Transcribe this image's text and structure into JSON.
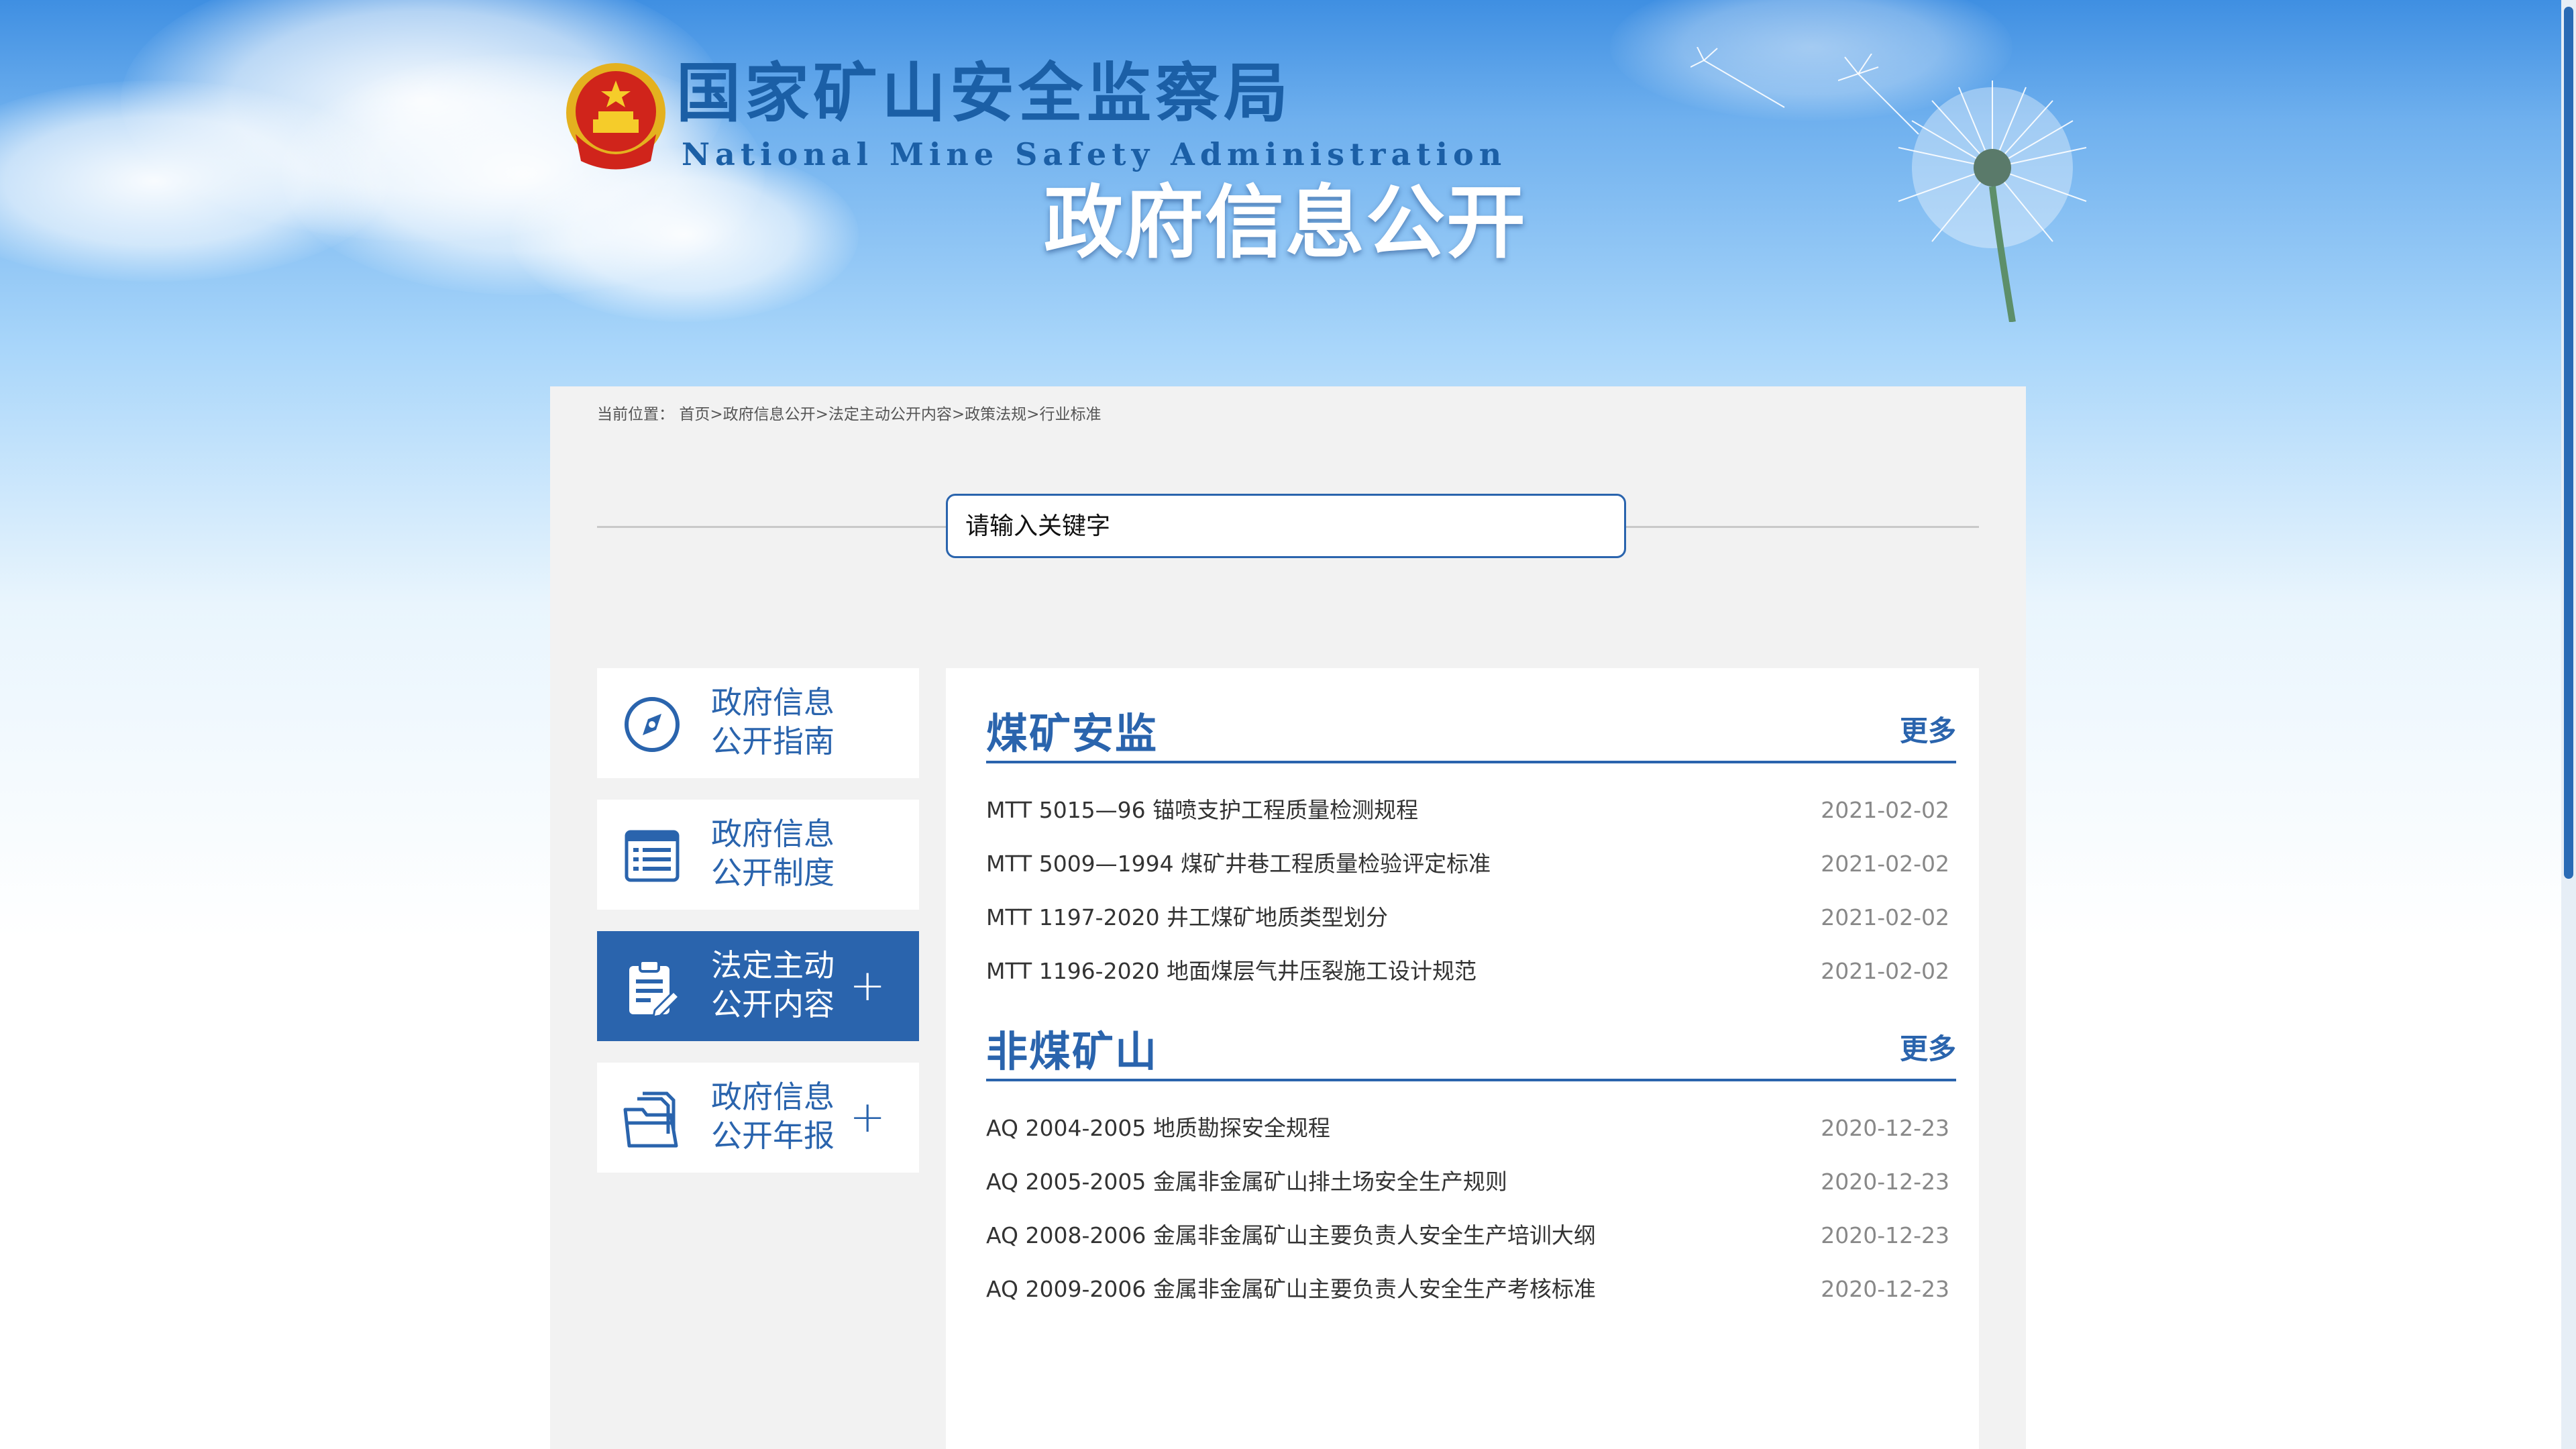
{
  "header": {
    "site_name": "国家矿山安全监察局",
    "site_name_en": "National Mine Safety Administration",
    "banner_title": "政府信息公开"
  },
  "breadcrumb": {
    "prefix": "当前位置：",
    "items": [
      "首页",
      "政府信息公开",
      "法定主动公开内容",
      "政策法规",
      "行业标准"
    ],
    "separator": ">"
  },
  "search": {
    "placeholder": "请输入关键字",
    "value": ""
  },
  "side_nav": {
    "items": [
      {
        "label": "政府信息\n公开指南",
        "icon": "compass-icon",
        "has_plus": false,
        "active": false
      },
      {
        "label": "政府信息\n公开制度",
        "icon": "list-document-icon",
        "has_plus": false,
        "active": false
      },
      {
        "label": "法定主动\n公开内容",
        "icon": "clipboard-edit-icon",
        "has_plus": true,
        "active": true
      },
      {
        "label": "政府信息\n公开年报",
        "icon": "folder-files-icon",
        "has_plus": true,
        "active": false
      }
    ],
    "plus_symbol": "+"
  },
  "sections": [
    {
      "title": "煤矿安监",
      "more": "更多",
      "items": [
        {
          "title": "MTT 5015—96 锚喷支护工程质量检测规程",
          "date": "2021-02-02"
        },
        {
          "title": "MTT 5009—1994 煤矿井巷工程质量检验评定标准",
          "date": "2021-02-02"
        },
        {
          "title": "MTT 1197-2020 井工煤矿地质类型划分",
          "date": "2021-02-02"
        },
        {
          "title": "MTT 1196-2020 地面煤层气井压裂施工设计规范",
          "date": "2021-02-02"
        }
      ]
    },
    {
      "title": "非煤矿山",
      "more": "更多",
      "items": [
        {
          "title": "AQ 2004-2005 地质勘探安全规程",
          "date": "2020-12-23"
        },
        {
          "title": "AQ 2005-2005 金属非金属矿山排土场安全生产规则",
          "date": "2020-12-23"
        },
        {
          "title": "AQ 2008-2006 金属非金属矿山主要负责人安全生产培训大纲",
          "date": "2020-12-23"
        },
        {
          "title": "AQ 2009-2006 金属非金属矿山主要负责人安全生产考核标准",
          "date": "2020-12-23"
        }
      ]
    }
  ],
  "colors": {
    "brand_blue": "#2a64ad",
    "panel_bg": "#f2f2f2",
    "date_gray": "#888888"
  }
}
